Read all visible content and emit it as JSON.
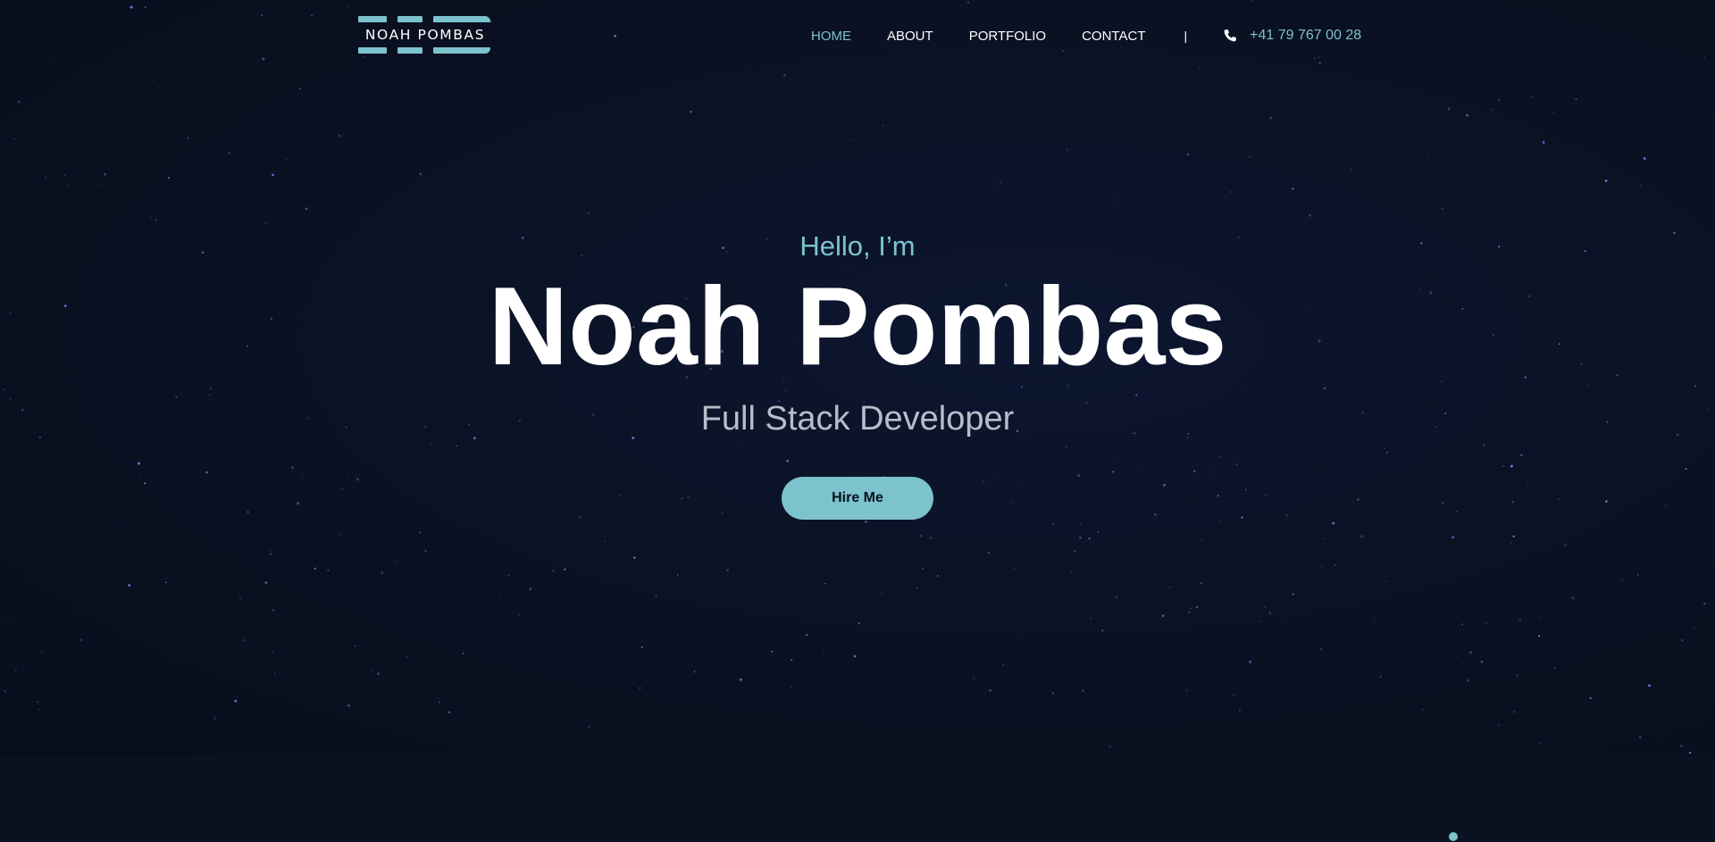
{
  "header": {
    "logo_text": "NOAH POMBAS",
    "nav": [
      {
        "label": "HOME",
        "active": true
      },
      {
        "label": "ABOUT",
        "active": false
      },
      {
        "label": "PORTFOLIO",
        "active": false
      },
      {
        "label": "CONTACT",
        "active": false
      }
    ],
    "separator": "|",
    "phone": "+41 79 767 00 28",
    "phone_icon": "phone-icon"
  },
  "hero": {
    "greeting": "Hello, I’m",
    "name": "Noah Pombas",
    "role": "Full Stack Developer",
    "cta_label": "Hire Me"
  },
  "colors": {
    "accent": "#7cc3cd",
    "background": "#0a1020",
    "text": "#ffffff",
    "muted": "#b7bdc9"
  }
}
